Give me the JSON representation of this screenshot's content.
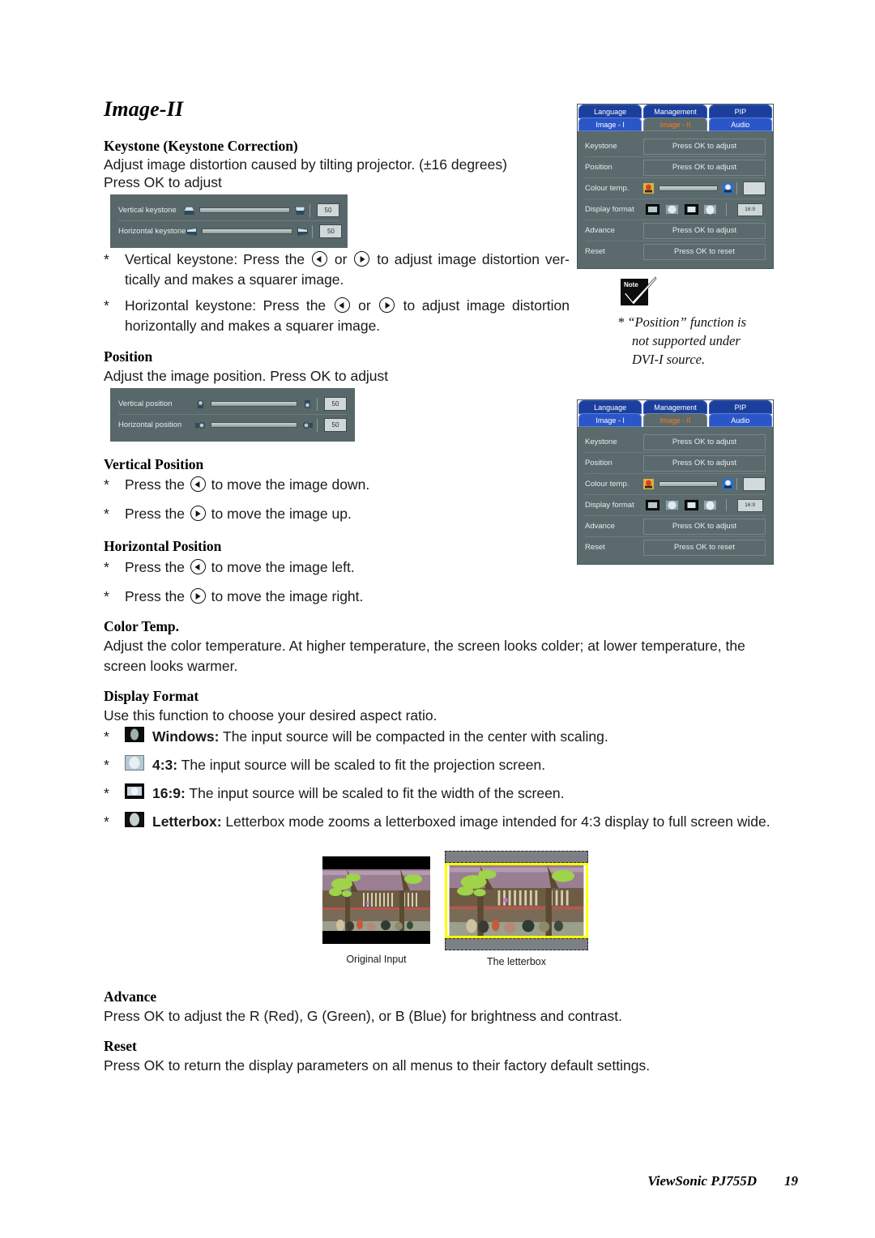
{
  "page": {
    "title": "Image-II",
    "footer_brand": "ViewSonic PJ755D",
    "footer_page": "19"
  },
  "sections": {
    "keystone": {
      "heading": "Keystone (Keystone Correction)",
      "line1": "Adjust image distortion caused by tilting projector. (±16 degrees)",
      "line2": "Press OK to adjust",
      "widget": {
        "rows": [
          {
            "label": "Vertical keystone",
            "value": "50"
          },
          {
            "label": "Horizontal keystone",
            "value": "50"
          }
        ]
      },
      "bullets": [
        {
          "marker": "*",
          "pre": "Vertical keystone: Press the ",
          "mid": " or ",
          "post": " to adjust image distortion ver-tically and makes a squarer image."
        },
        {
          "marker": "*",
          "pre": "Horizontal keystone: Press the ",
          "mid": " or ",
          "post": " to adjust image distortion horizontally and makes a squarer image."
        }
      ]
    },
    "position": {
      "heading": "Position",
      "line1": "Adjust the image position. Press OK to adjust",
      "widget": {
        "rows": [
          {
            "label": "Vertical position",
            "value": "50"
          },
          {
            "label": "Horizontal position",
            "value": "50"
          }
        ]
      }
    },
    "vertical_position": {
      "heading": "Vertical Position",
      "bullets": [
        {
          "marker": "*",
          "pre": "Press the ",
          "post": " to move the image down."
        },
        {
          "marker": "*",
          "pre": "Press the ",
          "post": " to move the image up."
        }
      ]
    },
    "horizontal_position": {
      "heading": "Horizontal Position",
      "bullets": [
        {
          "marker": "*",
          "pre": "Press the ",
          "post": " to move the image left."
        },
        {
          "marker": "*",
          "pre": "Press the ",
          "post": " to move the image right."
        }
      ]
    },
    "color_temp": {
      "heading": "Color Temp.",
      "body": "Adjust the color temperature. At higher temperature, the screen looks colder; at lower temperature, the screen looks warmer."
    },
    "display_format": {
      "heading": "Display Format",
      "intro": "Use this function to choose your desired aspect ratio.",
      "items": [
        {
          "marker": "*",
          "icon": "windows-format-icon",
          "term": "Windows:",
          "text": " The input source will be compacted in the center with scaling."
        },
        {
          "marker": "*",
          "icon": "four-three-format-icon",
          "term": "4:3:",
          "text": " The input source will be scaled to fit the projection screen."
        },
        {
          "marker": "*",
          "icon": "sixteen-nine-format-icon",
          "term": "16:9:",
          "text": " The input source will be scaled to fit the width of the screen."
        },
        {
          "marker": "*",
          "icon": "letterbox-format-icon",
          "term": "Letterbox:",
          "text": " Letterbox mode zooms a letterboxed image intended for 4:3 display to full screen wide."
        }
      ],
      "figures": [
        {
          "caption": "Original Input"
        },
        {
          "caption": "The letterbox"
        }
      ]
    },
    "advance": {
      "heading": "Advance",
      "body": "Press OK to adjust the R (Red), G (Green), or B (Blue) for brightness and contrast."
    },
    "reset": {
      "heading": "Reset",
      "body": "Press OK to return the display parameters on all menus to their factory default settings."
    }
  },
  "note": {
    "badge": "Note",
    "line1": "* “Position” function is",
    "line2": "not supported under",
    "line3": "DVI-I source."
  },
  "osd": {
    "tabs_top": [
      {
        "label": "Language",
        "active": false
      },
      {
        "label": "Management",
        "active": false
      },
      {
        "label": "PIP",
        "active": false
      }
    ],
    "tabs_bottom": [
      {
        "label": "Image - I",
        "active": false
      },
      {
        "label": "Image - II",
        "active": true
      },
      {
        "label": "Audio",
        "active": false
      }
    ],
    "rows": [
      {
        "label": "Keystone",
        "type": "action",
        "value": "Press OK to adjust"
      },
      {
        "label": "Position",
        "type": "action",
        "value": "Press OK to adjust"
      },
      {
        "label": "Colour temp.",
        "type": "slider",
        "value": ""
      },
      {
        "label": "Display format",
        "type": "formats",
        "value": "16:9"
      },
      {
        "label": "Advance",
        "type": "action",
        "value": "Press OK to adjust"
      },
      {
        "label": "Reset",
        "type": "action",
        "value": "Press OK to reset"
      }
    ]
  },
  "colors": {
    "osd_bg": "#5b6a6d",
    "tab_blue": "#1c3f9e",
    "tab_sub_blue": "#2a56c8",
    "active_tab_text": "#ff7a18",
    "widget_bg": "#58676a",
    "letterbox_border": "#ffff00"
  }
}
